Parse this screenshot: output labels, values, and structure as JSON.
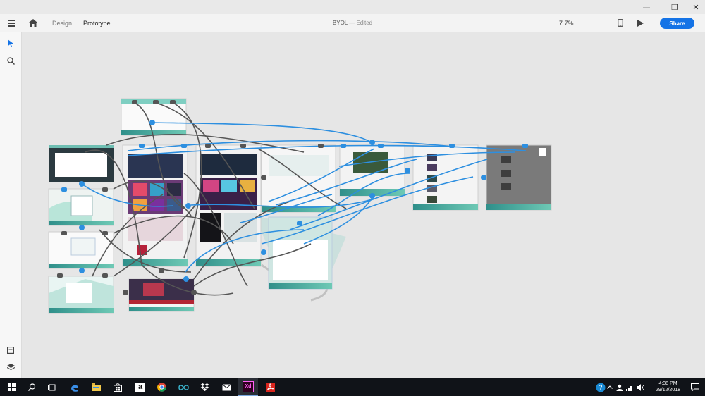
{
  "window": {
    "minimize_glyph": "—",
    "restore_glyph": "❐",
    "close_glyph": "✕"
  },
  "appbar": {
    "tabs": [
      {
        "label": "Design"
      },
      {
        "label": "Prototype"
      }
    ],
    "doc_name": "BYOL",
    "separator": "—",
    "status": "Edited",
    "zoom": "7.7%",
    "share_label": "Share"
  },
  "tools": [
    {
      "name": "select-icon"
    },
    {
      "name": "zoom-icon"
    },
    {
      "name": "assets-icon"
    },
    {
      "name": "layers-icon"
    }
  ],
  "taskbar": {
    "apps": [
      "windows-start-icon",
      "search-icon",
      "task-view-icon",
      "edge-icon",
      "file-explorer-icon",
      "store-icon",
      "amazon-icon",
      "chrome-icon",
      "infinity-icon",
      "dropbox-icon",
      "mail-icon",
      "adobe-xd-icon",
      "acrobat-icon"
    ],
    "xd_label": "Xd",
    "amazon_label": "a",
    "time": "4:38 PM",
    "date": "29/12/2018"
  },
  "colors": {
    "accent": "#1473e6",
    "wire_blue": "#2d8fe0",
    "wire_grey": "#555555",
    "teal": "#3aa79a"
  }
}
